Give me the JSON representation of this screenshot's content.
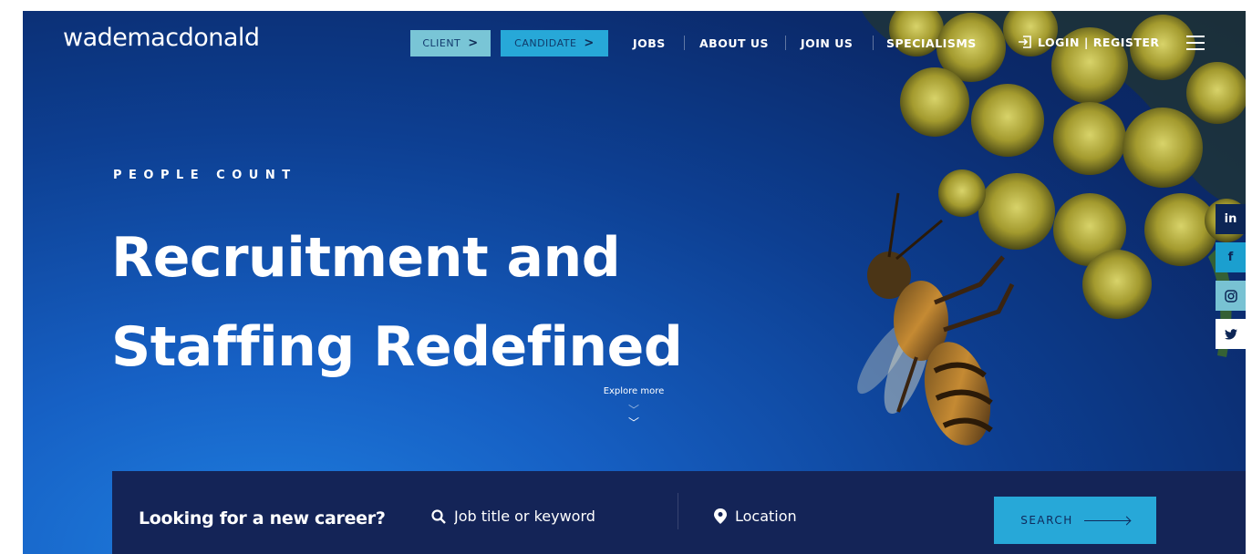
{
  "brand": {
    "logo_text": "wademacdonald"
  },
  "nav": {
    "client_label": "CLIENT",
    "candidate_label": "CANDIDATE",
    "links": [
      "JOBS",
      "ABOUT US",
      "JOIN US",
      "SPECIALISMS"
    ],
    "login_label": "LOGIN | REGISTER"
  },
  "hero": {
    "eyebrow": "PEOPLE COUNT",
    "headline_line1": "Recruitment and",
    "headline_line2": "Staffing Redefined",
    "explore_label": "Explore more"
  },
  "social": {
    "linkedin": "in",
    "facebook": "f",
    "instagram_icon": "instagram-icon",
    "twitter_icon": "twitter-icon"
  },
  "search": {
    "heading": "Looking for a new career?",
    "keyword_placeholder": "Job title or keyword",
    "location_placeholder": "Location",
    "button_label": "SEARCH"
  },
  "colors": {
    "hero_dark": "#0b2a6b",
    "hero_bright": "#1f7fe0",
    "accent_cyan": "#27a8d8",
    "accent_light": "#79c5d6",
    "searchbar_bg": "#142457"
  }
}
